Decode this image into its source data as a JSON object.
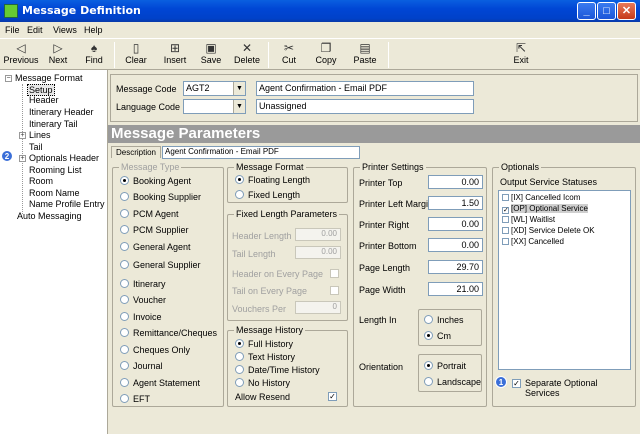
{
  "window": {
    "title": "Message Definition",
    "minimize": "_",
    "maximize": "□",
    "close": "✕"
  },
  "menu": [
    "File",
    "Edit",
    "Views",
    "Help"
  ],
  "toolbar": {
    "previous": "Previous",
    "next": "Next",
    "find": "Find",
    "clear": "Clear",
    "insert": "Insert",
    "save": "Save",
    "delete": "Delete",
    "cut": "Cut",
    "copy": "Copy",
    "paste": "Paste",
    "exit": "Exit"
  },
  "tree": {
    "root": "Message Format",
    "items": [
      "Setup",
      "Header",
      "Itinerary Header",
      "Itinerary Tail",
      "Lines",
      "Tail",
      "Optionals Header",
      "Rooming List",
      "Room",
      "Room Name",
      "Name Profile Entry"
    ],
    "last": "Auto Messaging",
    "badge2": "2"
  },
  "header": {
    "message_code_label": "Message Code",
    "message_code": "AGT2",
    "message_code_desc": "Agent Confirmation - Email PDF",
    "language_code_label": "Language Code",
    "language_code": "",
    "language_desc": "Unassigned"
  },
  "banner": "Message Parameters",
  "description": {
    "tab": "Description",
    "value": "Agent Confirmation - Email PDF"
  },
  "message_type": {
    "title": "Message Type",
    "options": [
      "Booking Agent",
      "Booking Supplier",
      "PCM Agent",
      "PCM Supplier",
      "General Agent",
      "General Supplier",
      "Itinerary",
      "Voucher",
      "Invoice",
      "Remittance/Cheques",
      "Cheques Only",
      "Journal",
      "Agent Statement",
      "EFT"
    ]
  },
  "message_format": {
    "title": "Message Format",
    "options": [
      "Floating Length",
      "Fixed Length"
    ]
  },
  "fixed_length": {
    "title": "Fixed Length Parameters",
    "header_length_label": "Header Length",
    "header_length": "0.00",
    "tail_length_label": "Tail Length",
    "tail_length": "0.00",
    "header_every_page": "Header on Every Page",
    "tail_every_page": "Tail on Every Page",
    "vouchers_per_label": "Vouchers Per",
    "vouchers_per": "0"
  },
  "message_history": {
    "title": "Message History",
    "options": [
      "Full History",
      "Text History",
      "Date/Time History",
      "No History"
    ],
    "allow_resend": "Allow Resend",
    "allow_resend_check": "✓"
  },
  "printer": {
    "title": "Printer Settings",
    "top_label": "Printer Top",
    "top": "0.00",
    "left_margin_label": "Printer Left Margin",
    "left_margin": "1.50",
    "right_label": "Printer Right",
    "right": "0.00",
    "bottom_label": "Printer Bottom",
    "bottom": "0.00",
    "page_length_label": "Page Length",
    "page_length": "29.70",
    "page_width_label": "Page Width",
    "page_width": "21.00",
    "length_in_label": "Length In",
    "length_in": [
      "Inches",
      "Cm"
    ],
    "orientation_label": "Orientation",
    "orientation": [
      "Portrait",
      "Landscape"
    ]
  },
  "optionals": {
    "title": "Optionals",
    "statuses_label": "Output Service Statuses",
    "statuses": [
      {
        "label": "[IX] Cancelled Icom",
        "check": ""
      },
      {
        "label": "[OP] Optional Service",
        "check": "✓"
      },
      {
        "label": "[WL] Waitlist",
        "check": ""
      },
      {
        "label": "[XD] Service Delete OK",
        "check": ""
      },
      {
        "label": "[XX] Cancelled",
        "check": ""
      }
    ],
    "separate_line1": "Separate Optional",
    "separate_line2": "Services",
    "separate_check": "✓",
    "badge1": "1"
  }
}
